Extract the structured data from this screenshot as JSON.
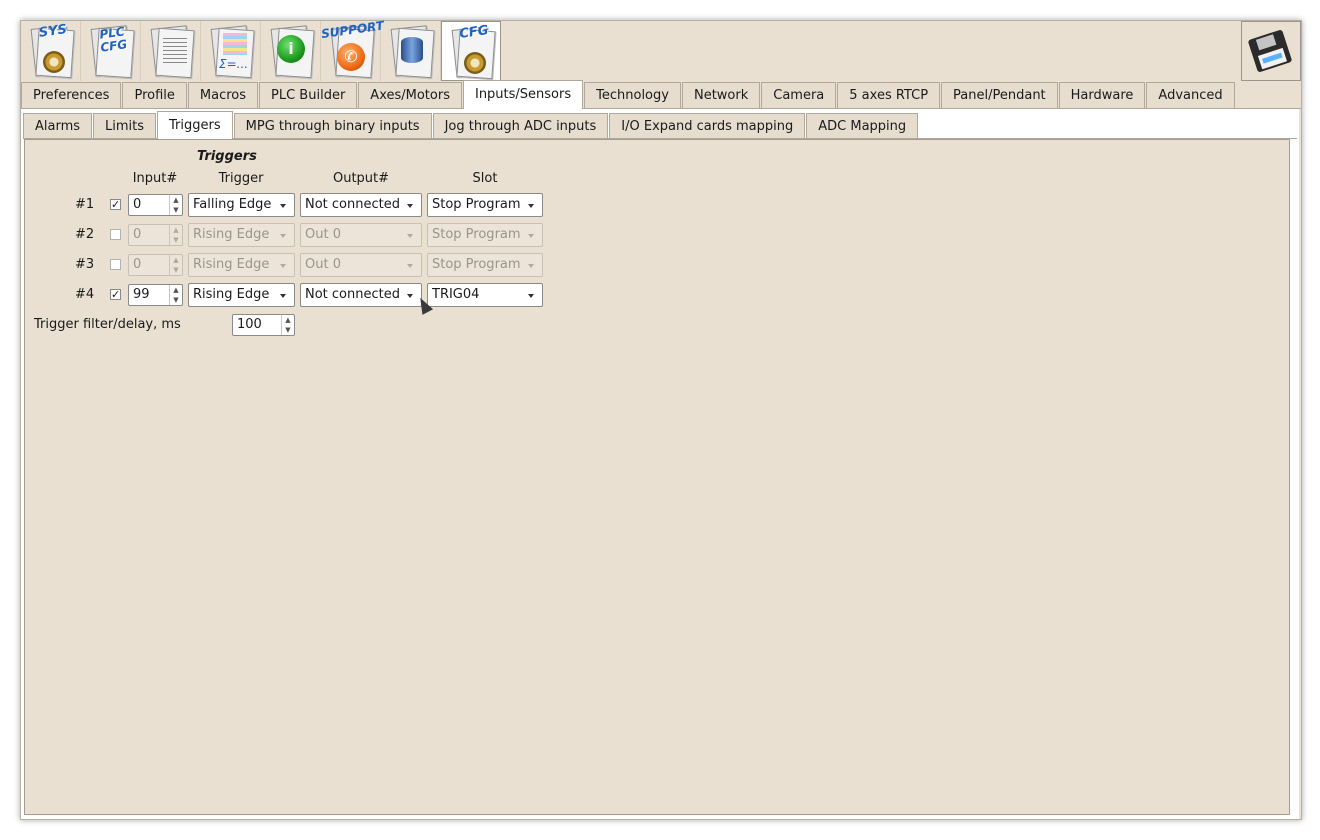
{
  "toolbar": {
    "buttons": [
      {
        "name": "sys-config",
        "caption": "SYS"
      },
      {
        "name": "plc-config",
        "caption": "PLC CFG"
      },
      {
        "name": "log"
      },
      {
        "name": "variables",
        "caption": "Σ=..."
      },
      {
        "name": "info",
        "caption": "i"
      },
      {
        "name": "support",
        "caption": "SUPPORT"
      },
      {
        "name": "database"
      },
      {
        "name": "cfg",
        "caption": "CFG",
        "active": true
      }
    ],
    "save_icon": "floppy-disk-icon"
  },
  "main_tabs": [
    "Preferences",
    "Profile",
    "Macros",
    "PLC Builder",
    "Axes/Motors",
    "Inputs/Sensors",
    "Technology",
    "Network",
    "Camera",
    "5 axes RTCP",
    "Panel/Pendant",
    "Hardware",
    "Advanced"
  ],
  "main_tab_selected": "Inputs/Sensors",
  "sub_tabs": [
    "Alarms",
    "Limits",
    "Triggers",
    "MPG through binary inputs",
    "Jog through ADC inputs",
    "I/O Expand cards mapping",
    "ADC Mapping"
  ],
  "sub_tab_selected": "Triggers",
  "triggers": {
    "title": "Triggers",
    "columns": {
      "input": "Input#",
      "trigger": "Trigger",
      "output": "Output#",
      "slot": "Slot"
    },
    "rows": [
      {
        "label": "#1",
        "enabled": true,
        "input": "0",
        "trigger": "Falling Edge",
        "output": "Not connected",
        "slot": "Stop Program"
      },
      {
        "label": "#2",
        "enabled": false,
        "input": "0",
        "trigger": "Rising Edge",
        "output": "Out 0",
        "slot": "Stop Program"
      },
      {
        "label": "#3",
        "enabled": false,
        "input": "0",
        "trigger": "Rising Edge",
        "output": "Out 0",
        "slot": "Stop Program"
      },
      {
        "label": "#4",
        "enabled": true,
        "input": "99",
        "trigger": "Rising Edge",
        "output": "Not connected",
        "slot": "TRIG04"
      }
    ],
    "filter_label": "Trigger filter/delay, ms",
    "filter_value": "100"
  },
  "colors": {
    "window_bg": "#e9e0d2",
    "tab_selected": "#ffffff",
    "accent_icon_text": "#1e63c4"
  }
}
